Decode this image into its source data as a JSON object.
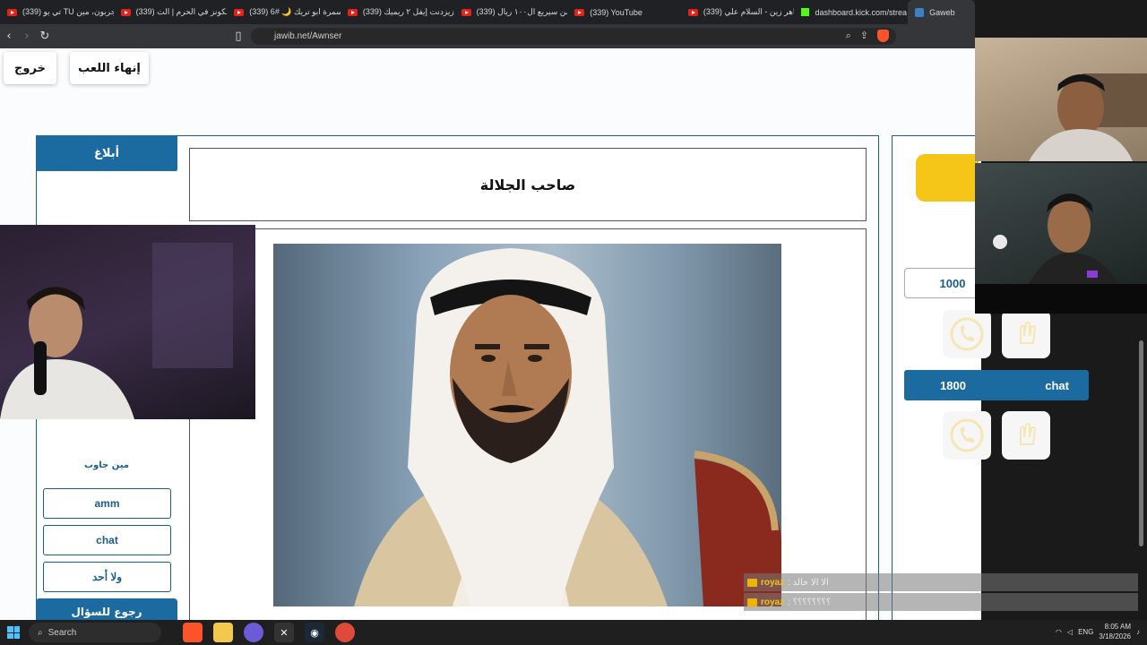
{
  "browser": {
    "tabs": [
      {
        "label": "(339) تي يو TU يجربون، مين",
        "icon": "youtube-icon"
      },
      {
        "label": "(339) فالكونز في الحرم | الت",
        "icon": "youtube-icon"
      },
      {
        "label": "(339) سمرة ابو تريك 🌙 #6",
        "icon": "youtube-icon"
      },
      {
        "label": "(339) زيزدنت إيفل ٢ ريميك",
        "icon": "youtube-icon"
      },
      {
        "label": "(339) من سيريع ال١٠٠ ريال",
        "icon": "youtube-icon"
      },
      {
        "label": "(339) YouTube",
        "icon": "youtube-icon"
      },
      {
        "label": "(339) ماهر زين - السلام علي",
        "icon": "youtube-icon"
      },
      {
        "label": "dashboard.kick.com/strea",
        "icon": "kick-icon"
      },
      {
        "label": "Gaweb",
        "icon": "gaweb-icon"
      }
    ],
    "url": "jawib.net/Awnser"
  },
  "game": {
    "exit_label": "خروج",
    "end_game_label": "إنهاء اللعب",
    "report_label": "أبلاغ",
    "question": "صاحب الجلالة",
    "who_answered_label": "مين جاوب",
    "answer_options": [
      "amm",
      "chat",
      "ولا أحد"
    ],
    "back_label": "رجوع للسؤال",
    "team1_score": "1000",
    "team2_score": "1800",
    "team2_name": "chat",
    "accent_color": "#1b6aa0",
    "highlight_color": "#f5c518"
  },
  "chat_overlay": [
    {
      "user": "royaz",
      "message": ": الا الا خالد"
    },
    {
      "user": "royaz",
      "message": ": ؟؟؟؟؟؟؟؟"
    }
  ],
  "taskbar": {
    "search_placeholder": "Search",
    "lang": "ENG",
    "time": "8:05 AM",
    "date": "3/18/2026"
  }
}
